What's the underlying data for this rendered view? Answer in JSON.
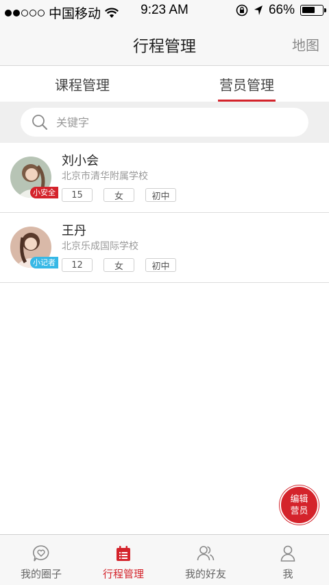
{
  "status_bar": {
    "carrier": "中国移动",
    "time": "9:23 AM",
    "battery": "66%",
    "battery_level": 0.66
  },
  "nav": {
    "title": "行程管理",
    "right_label": "地图"
  },
  "tabs": [
    {
      "label": "课程管理",
      "active": false
    },
    {
      "label": "营员管理",
      "active": true
    }
  ],
  "search": {
    "placeholder": "关键字"
  },
  "campers": [
    {
      "name": "刘小会",
      "school": "北京市清华附属学校",
      "badge": "小安全",
      "badge_color": "#d4232b",
      "age": "15",
      "gender": "女",
      "grade": "初中"
    },
    {
      "name": "王丹",
      "school": "北京乐成国际学校",
      "badge": "小记者",
      "badge_color": "#37b8e6",
      "age": "12",
      "gender": "女",
      "grade": "初中"
    }
  ],
  "fab": {
    "line1": "编辑",
    "line2": "营员"
  },
  "tabbar": [
    {
      "label": "我的圈子",
      "icon": "heart-bubble-icon",
      "active": false
    },
    {
      "label": "行程管理",
      "icon": "calendar-list-icon",
      "active": true
    },
    {
      "label": "我的好友",
      "icon": "friends-icon",
      "active": false
    },
    {
      "label": "我",
      "icon": "person-icon",
      "active": false
    }
  ],
  "colors": {
    "accent": "#d4232b",
    "badge_blue": "#37b8e6"
  }
}
